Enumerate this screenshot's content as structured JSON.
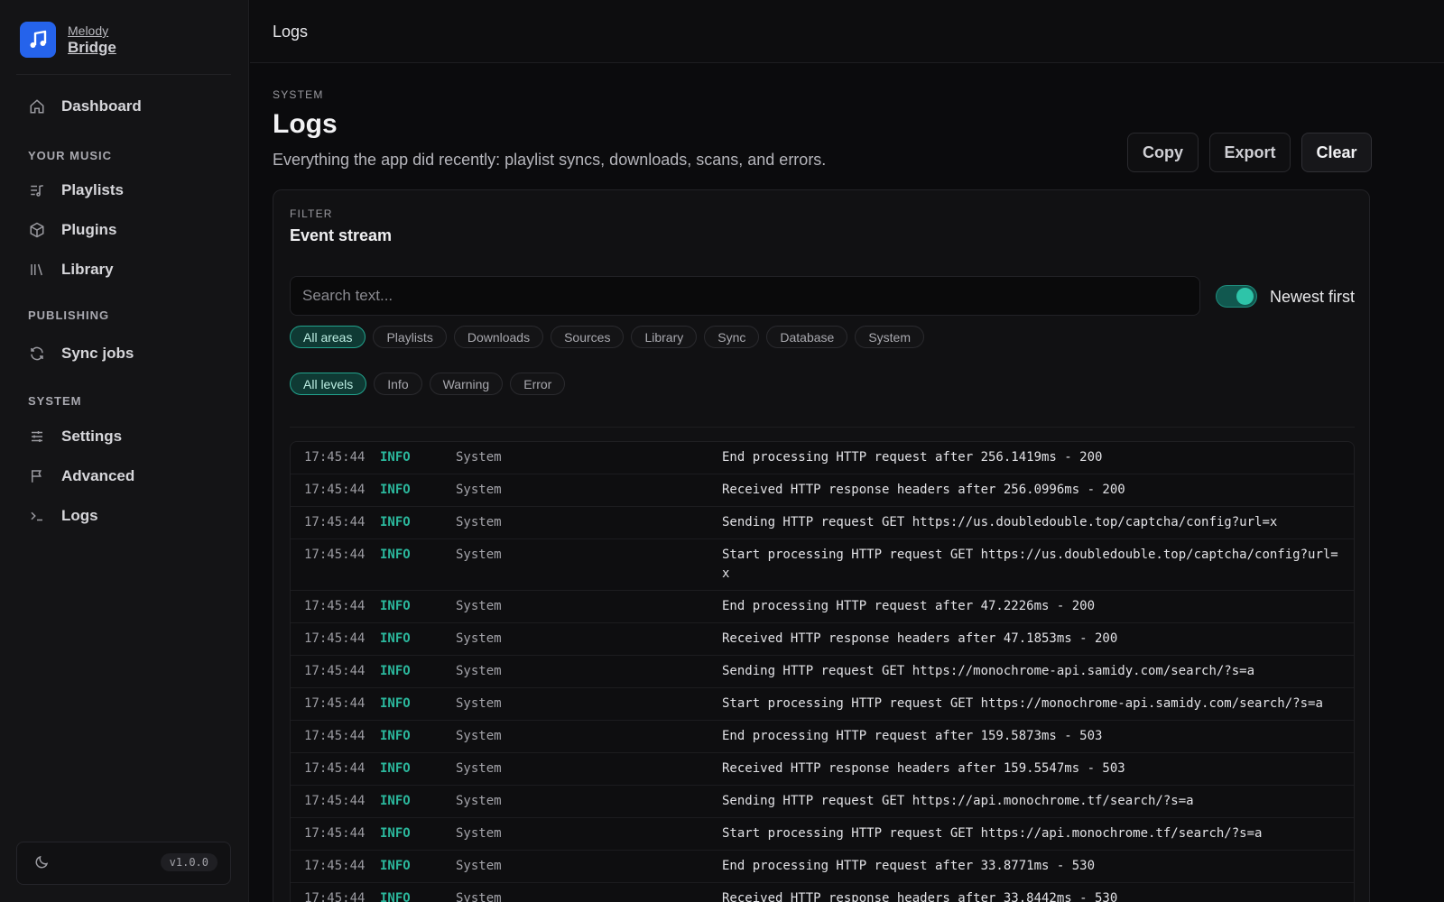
{
  "brand": {
    "line1": "Melody",
    "line2": "Bridge"
  },
  "nav": {
    "dashboard": "Dashboard",
    "section_music": "YOUR MUSIC",
    "playlists": "Playlists",
    "plugins": "Plugins",
    "library": "Library",
    "section_publishing": "PUBLISHING",
    "sync_jobs": "Sync jobs",
    "section_system": "SYSTEM",
    "settings": "Settings",
    "advanced": "Advanced",
    "logs": "Logs"
  },
  "footer": {
    "version": "v1.0.0"
  },
  "topbar": {
    "title": "Logs"
  },
  "page": {
    "overline": "SYSTEM",
    "title": "Logs",
    "description": "Everything the app did recently: playlist syncs, downloads, scans, and errors."
  },
  "actions": {
    "copy": "Copy",
    "export": "Export",
    "clear": "Clear"
  },
  "panel": {
    "overline": "FILTER",
    "title": "Event stream",
    "search_placeholder": "Search text...",
    "newest_first_label": "Newest first",
    "newest_first_on": true
  },
  "areas": [
    "All areas",
    "Playlists",
    "Downloads",
    "Sources",
    "Library",
    "Sync",
    "Database",
    "System"
  ],
  "levels": [
    "All levels",
    "Info",
    "Warning",
    "Error"
  ],
  "logs": [
    {
      "time": "17:45:44",
      "level": "INFO",
      "area": "System",
      "message": "End processing HTTP request after 256.1419ms - 200"
    },
    {
      "time": "17:45:44",
      "level": "INFO",
      "area": "System",
      "message": "Received HTTP response headers after 256.0996ms - 200"
    },
    {
      "time": "17:45:44",
      "level": "INFO",
      "area": "System",
      "message": "Sending HTTP request GET https://us.doubledouble.top/captcha/config?url=x"
    },
    {
      "time": "17:45:44",
      "level": "INFO",
      "area": "System",
      "message": "Start processing HTTP request GET https://us.doubledouble.top/captcha/config?url=x"
    },
    {
      "time": "17:45:44",
      "level": "INFO",
      "area": "System",
      "message": "End processing HTTP request after 47.2226ms - 200"
    },
    {
      "time": "17:45:44",
      "level": "INFO",
      "area": "System",
      "message": "Received HTTP response headers after 47.1853ms - 200"
    },
    {
      "time": "17:45:44",
      "level": "INFO",
      "area": "System",
      "message": "Sending HTTP request GET https://monochrome-api.samidy.com/search/?s=a"
    },
    {
      "time": "17:45:44",
      "level": "INFO",
      "area": "System",
      "message": "Start processing HTTP request GET https://monochrome-api.samidy.com/search/?s=a"
    },
    {
      "time": "17:45:44",
      "level": "INFO",
      "area": "System",
      "message": "End processing HTTP request after 159.5873ms - 503"
    },
    {
      "time": "17:45:44",
      "level": "INFO",
      "area": "System",
      "message": "Received HTTP response headers after 159.5547ms - 503"
    },
    {
      "time": "17:45:44",
      "level": "INFO",
      "area": "System",
      "message": "Sending HTTP request GET https://api.monochrome.tf/search/?s=a"
    },
    {
      "time": "17:45:44",
      "level": "INFO",
      "area": "System",
      "message": "Start processing HTTP request GET https://api.monochrome.tf/search/?s=a"
    },
    {
      "time": "17:45:44",
      "level": "INFO",
      "area": "System",
      "message": "End processing HTTP request after 33.8771ms - 530"
    },
    {
      "time": "17:45:44",
      "level": "INFO",
      "area": "System",
      "message": "Received HTTP response headers after 33.8442ms - 530"
    }
  ],
  "colors": {
    "accent": "#2ec4a9",
    "brand": "#2563eb",
    "info": "#2bb89d"
  }
}
